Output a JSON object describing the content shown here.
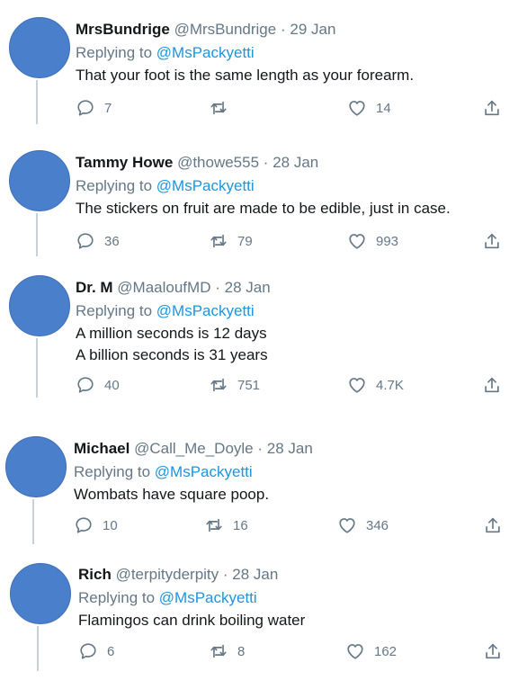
{
  "tweets": [
    {
      "name": "MrsBundrige",
      "handle": "@MrsBundrige",
      "sep": "·",
      "date": "29 Jan",
      "replying_label": "Replying to",
      "replying_to": "@MsPackyetti",
      "lines": [
        "That your foot is the same length as your forearm."
      ],
      "replies": "7",
      "retweets": "",
      "likes": "14"
    },
    {
      "name": "Tammy Howe",
      "handle": "@thowe555",
      "sep": "·",
      "date": "28 Jan",
      "replying_label": "Replying to",
      "replying_to": "@MsPackyetti",
      "lines": [
        "The stickers on fruit are made to be edible, just in case."
      ],
      "replies": "36",
      "retweets": "79",
      "likes": "993"
    },
    {
      "name": "Dr. M",
      "handle": "@MaaloufMD",
      "sep": "·",
      "date": "28 Jan",
      "replying_label": "Replying to",
      "replying_to": "@MsPackyetti",
      "lines": [
        "A million seconds is 12 days",
        "A billion seconds is 31 years"
      ],
      "replies": "40",
      "retweets": "751",
      "likes": "4.7K"
    },
    {
      "name": "Michael",
      "handle": "@Call_Me_Doyle",
      "sep": "·",
      "date": "28 Jan",
      "replying_label": "Replying to",
      "replying_to": "@MsPackyetti",
      "lines": [
        "Wombats have square poop."
      ],
      "replies": "10",
      "retweets": "16",
      "likes": "346"
    },
    {
      "name": "Rich",
      "handle": "@terpityderpity",
      "sep": "·",
      "date": "28 Jan",
      "replying_label": "Replying to",
      "replying_to": "@MsPackyetti",
      "lines": [
        "Flamingos can drink boiling water"
      ],
      "replies": "6",
      "retweets": "8",
      "likes": "162"
    }
  ]
}
